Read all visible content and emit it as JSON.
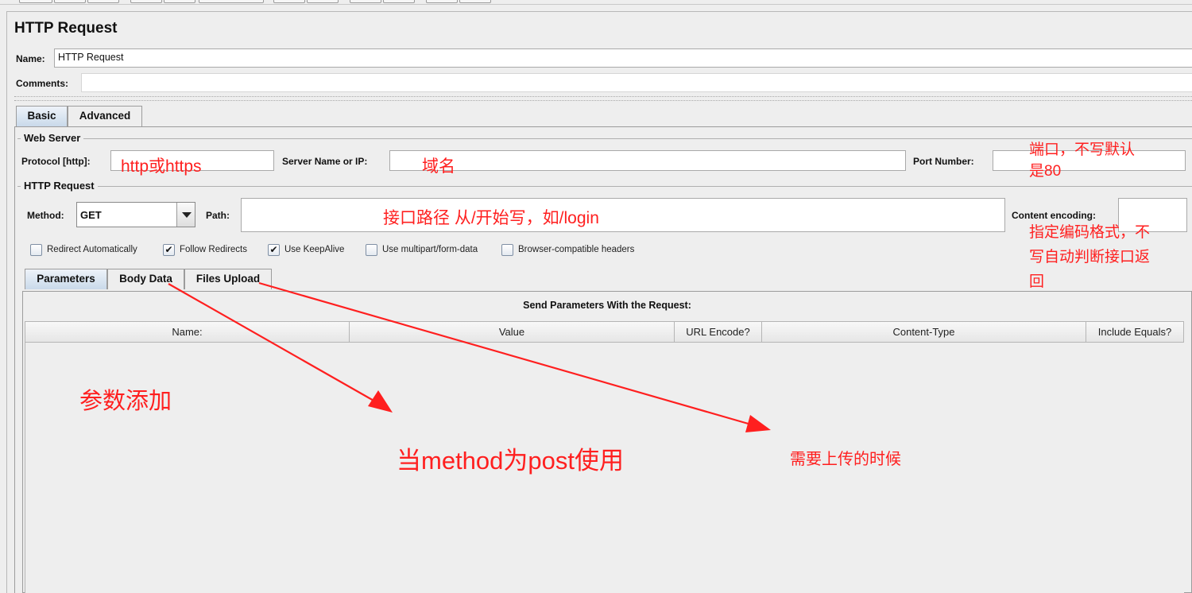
{
  "panel": {
    "title": "HTTP Request"
  },
  "name_row": {
    "label": "Name:",
    "value": "HTTP Request"
  },
  "comments_row": {
    "label": "Comments:",
    "value": ""
  },
  "tabs": [
    {
      "label": "Basic",
      "active": true
    },
    {
      "label": "Advanced",
      "active": false
    }
  ],
  "web_server": {
    "group_title": "Web Server",
    "protocol_label": "Protocol [http]:",
    "protocol_value": "",
    "server_label": "Server Name or IP:",
    "server_value": "",
    "port_label": "Port Number:",
    "port_value": ""
  },
  "http_request": {
    "group_title": "HTTP Request",
    "method_label": "Method:",
    "method_value": "GET",
    "path_label": "Path:",
    "path_value": "",
    "encoding_label": "Content encoding:",
    "encoding_value": ""
  },
  "options": [
    {
      "label": "Redirect Automatically",
      "checked": false
    },
    {
      "label": "Follow Redirects",
      "checked": true
    },
    {
      "label": "Use KeepAlive",
      "checked": true
    },
    {
      "label": "Use multipart/form-data",
      "checked": false
    },
    {
      "label": "Browser-compatible headers",
      "checked": false
    }
  ],
  "sub_tabs": [
    {
      "label": "Parameters",
      "active": true
    },
    {
      "label": "Body Data",
      "active": false
    },
    {
      "label": "Files Upload",
      "active": false
    }
  ],
  "params": {
    "heading": "Send Parameters With the Request:",
    "columns": [
      "Name:",
      "Value",
      "URL Encode?",
      "Content-Type",
      "Include Equals?"
    ]
  },
  "annotations": {
    "protocol": "http或https",
    "server": "域名",
    "port_line1": "端口，不写默认",
    "port_line2": "是80",
    "path": "接口路径  从/开始写，如/login",
    "encoding_line1": "指定编码格式，不",
    "encoding_line2": "写自动判断接口返",
    "encoding_line3": "回",
    "params": "参数添加",
    "body_data": "当method为post使用",
    "files_upload": "需要上传的时候"
  },
  "colors": {
    "annotation": "#ff1f1f",
    "active_tab": "#c9d9ea"
  }
}
